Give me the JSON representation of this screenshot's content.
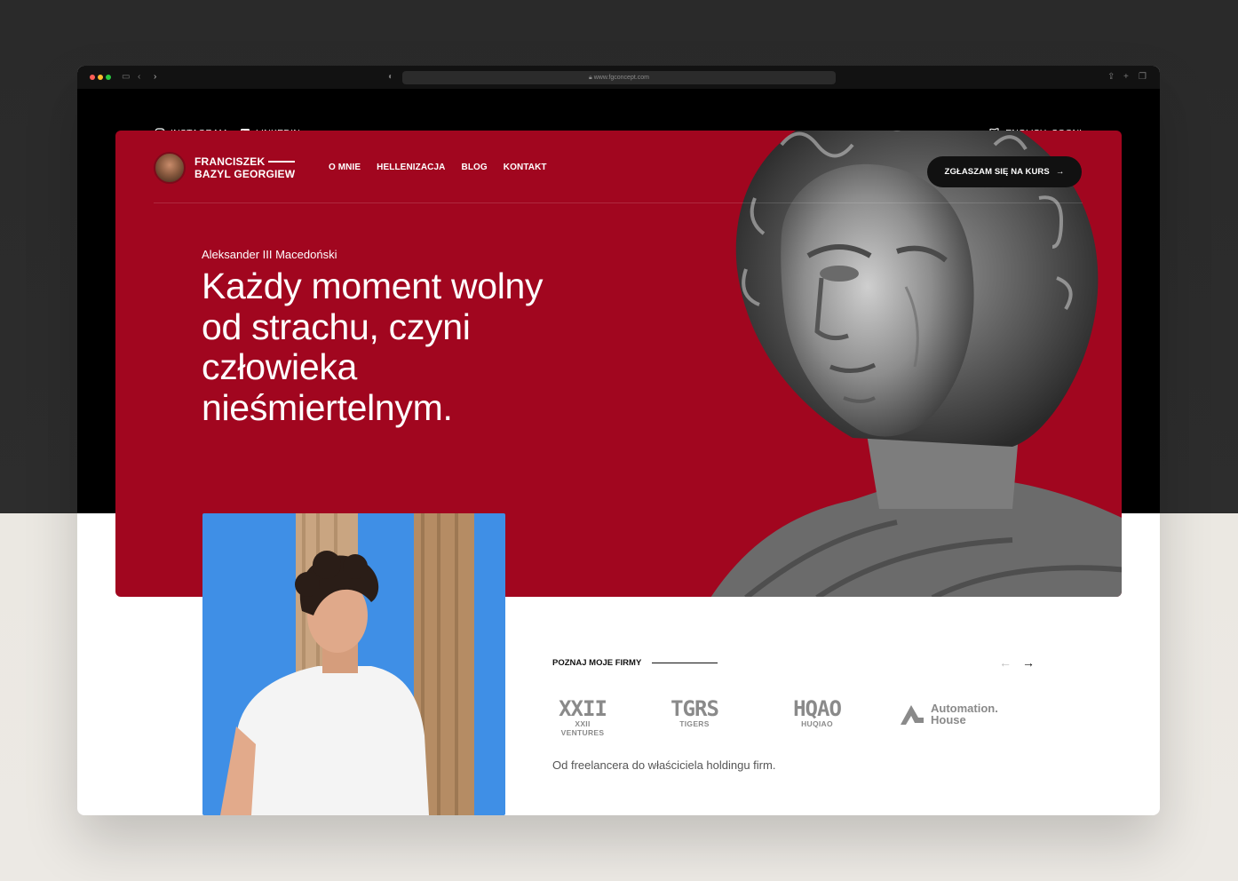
{
  "browser": {
    "url": "www.fgconcept.com"
  },
  "topbar": {
    "instagram_label": "INSTAGRAM",
    "linkedin_label": "LINKEDIN",
    "language_label": "ENGLISH, SOON!"
  },
  "header": {
    "brand_line1": "FRANCISZEK",
    "brand_line2": "BAZYL GEORGIEW",
    "nav": [
      "O MNIE",
      "HELLENIZACJA",
      "BLOG",
      "KONTAKT"
    ],
    "cta_label": "ZGŁASZAM SIĘ NA KURS"
  },
  "hero": {
    "quote_author": "Aleksander III Macedoński",
    "quote": "Każdy moment wolny od strachu, czyni człowieka nieśmiertelnym."
  },
  "firms": {
    "label": "POZNAJ MOJE FIRMY",
    "logos": [
      {
        "mark": "XXII",
        "name": "XXII VENTURES"
      },
      {
        "mark": "TGRS",
        "name": "TIGERS"
      },
      {
        "mark": "HQAO",
        "name": "HUQIAO"
      },
      {
        "mark": "Automation.",
        "name": "House"
      }
    ],
    "tagline": "Od freelancera do właściciela holdingu firm."
  },
  "colors": {
    "hero_red": "#a1061f",
    "dark": "#000000",
    "cta_bg": "#111111"
  }
}
